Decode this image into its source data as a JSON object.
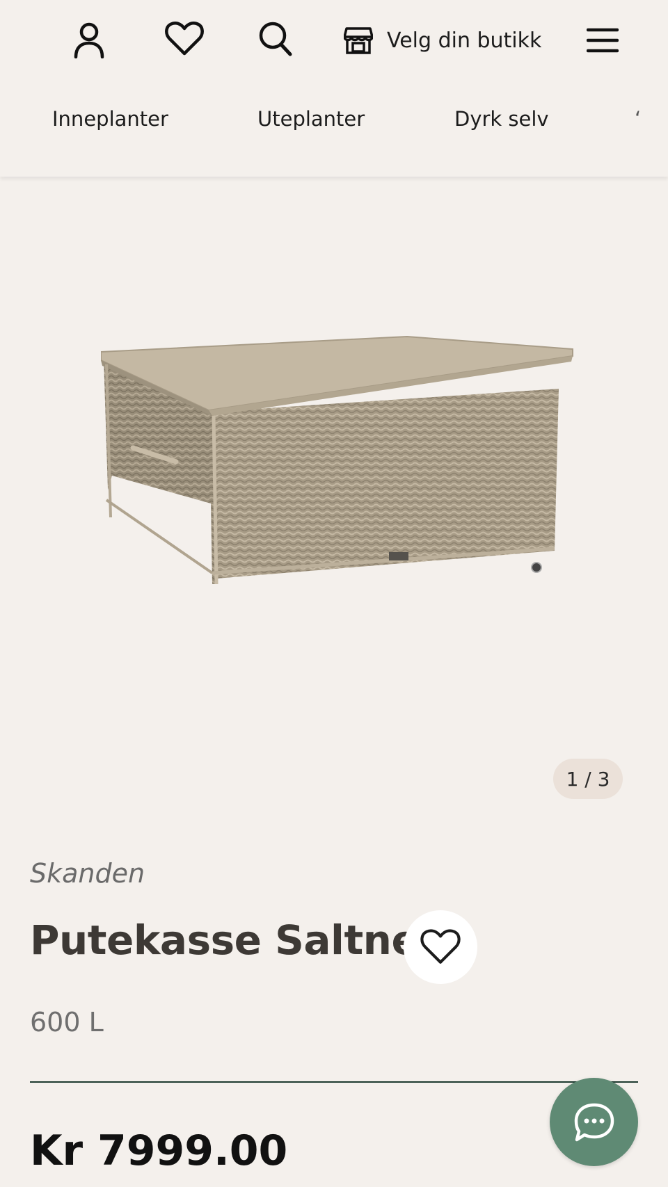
{
  "header": {
    "account_icon": "user-icon",
    "favorites_icon": "heart-icon",
    "search_icon": "search-icon",
    "store_icon": "store-icon",
    "store_label": "Velg din butikk",
    "menu_icon": "hamburger-menu-icon"
  },
  "nav": {
    "items": [
      {
        "label": "Inneplanter"
      },
      {
        "label": "Uteplanter"
      },
      {
        "label": "Dyrk selv"
      }
    ]
  },
  "gallery": {
    "current": "1",
    "total": "3",
    "counter_text": "1 / 3"
  },
  "product": {
    "brand": "Skanden",
    "title": "Putekasse Saltnes",
    "variant": "600 L",
    "price": "Kr 7999.00",
    "favorite_icon": "heart-icon"
  },
  "chat": {
    "icon": "chat-bubble-icon",
    "color": "#5f8a74"
  },
  "colors": {
    "background": "#f4f0ec",
    "counter_bg": "#ebe1d9",
    "divider": "#1d3a2f",
    "title": "#3d3935"
  }
}
